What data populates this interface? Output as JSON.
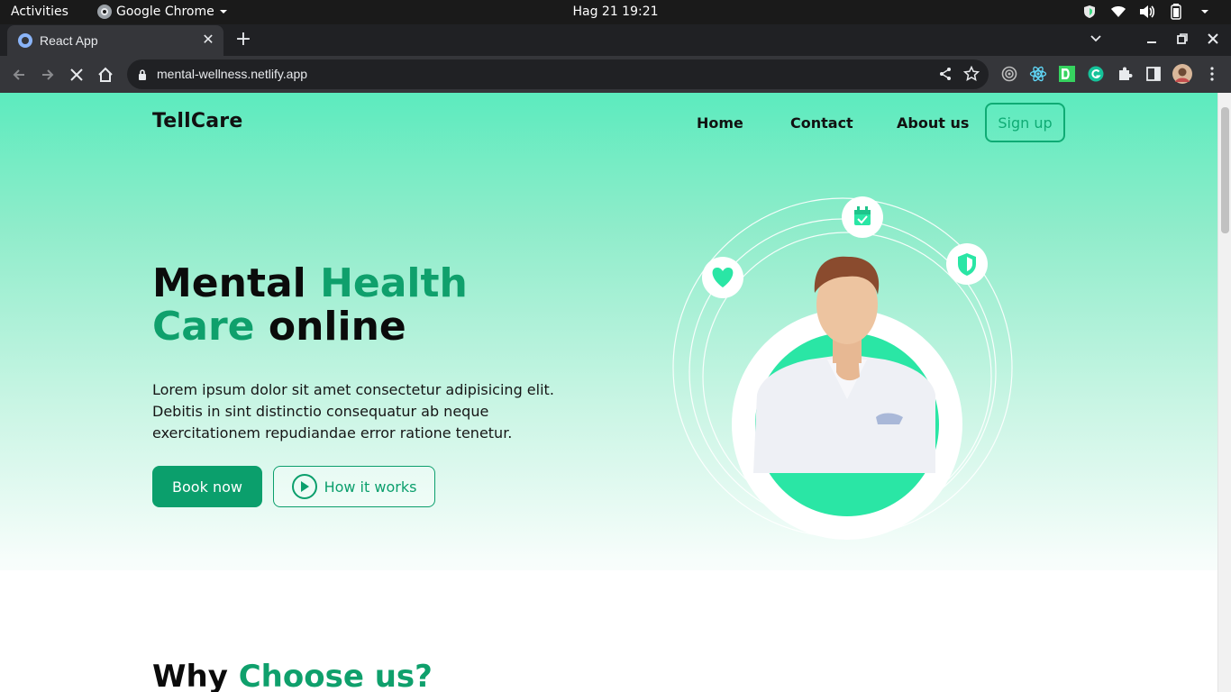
{
  "system_bar": {
    "activities": "Activities",
    "app_name": "Google Chrome",
    "clock": "Hag 21  19:21"
  },
  "browser": {
    "tab_title": "React App",
    "url": "mental-wellness.netlify.app"
  },
  "site": {
    "brand": "TellCare",
    "nav": [
      "Home",
      "Contact",
      "About us"
    ],
    "signup_label": "Sign up"
  },
  "hero": {
    "title_part1": "Mental ",
    "title_accent1": "Health",
    "title_accent2": "Care",
    "title_part2": " online",
    "description": "Lorem ipsum dolor sit amet consectetur adipisicing elit. Debitis in sint distinctio consequatur ab neque exercitationem repudiandae error ratione tenetur.",
    "book_label": "Book now",
    "how_label": "How it works"
  },
  "section": {
    "title_part1": "Why ",
    "title_accent": "Choose us?"
  },
  "colors": {
    "accent": "#0fa06c",
    "hero_top": "#5cebbe",
    "illustration_green": "#2ae6a5"
  },
  "icons": [
    "calendar-check-icon",
    "heart-icon",
    "shield-icon",
    "play-icon"
  ]
}
